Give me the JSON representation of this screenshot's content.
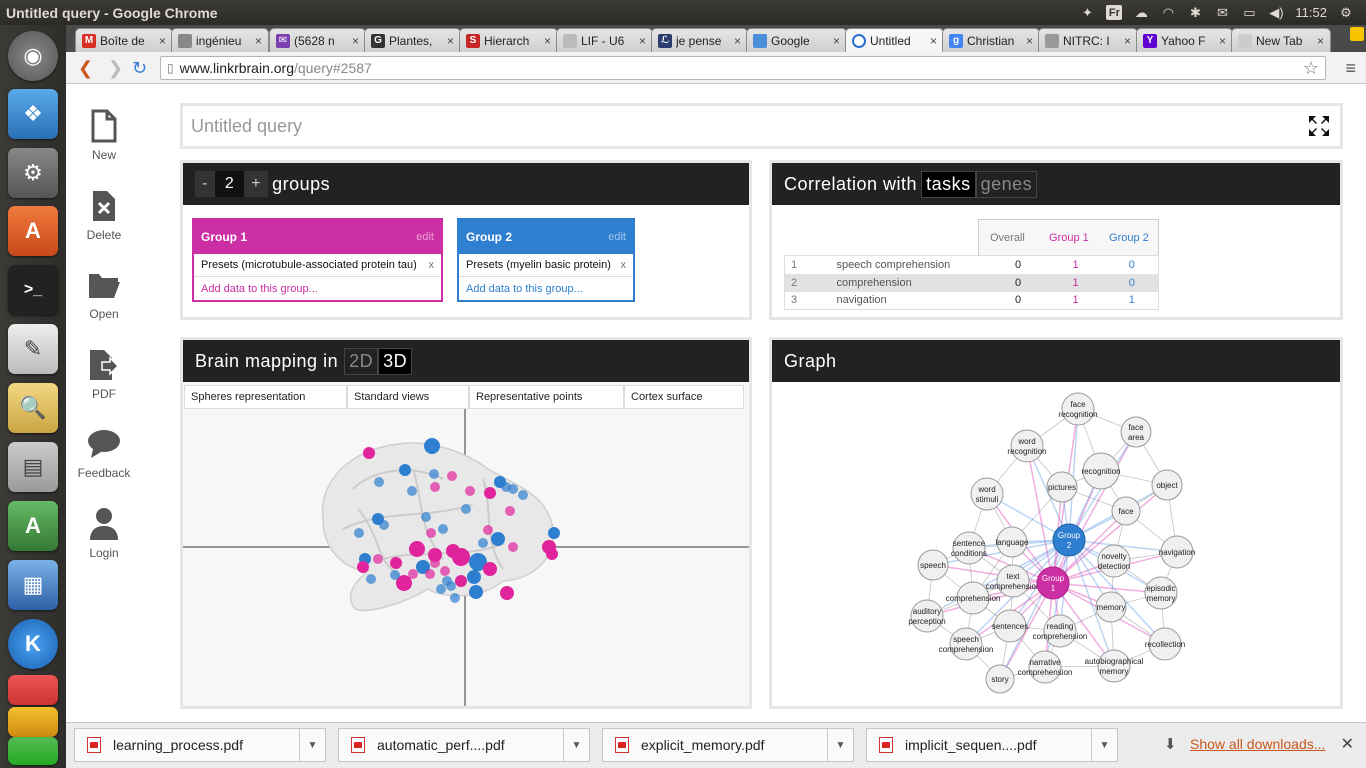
{
  "window": {
    "title": "Untitled query - Google Chrome"
  },
  "tray": {
    "lang": "Fr",
    "time": "11:52"
  },
  "tabs": [
    {
      "label": "Boîte de",
      "fav": "M",
      "color": "#d93025"
    },
    {
      "label": "ingénieu",
      "fav": "",
      "color": "#888888"
    },
    {
      "label": "(5628 n",
      "fav": "✉",
      "color": "#7b3fb0"
    },
    {
      "label": "Plantes,",
      "fav": "G",
      "color": "#333333"
    },
    {
      "label": "Hierarch",
      "fav": "S",
      "color": "#c62828"
    },
    {
      "label": "LIF - U6",
      "fav": "",
      "color": "#bbbbbb"
    },
    {
      "label": "je pense",
      "fav": "ℒ",
      "color": "#2c3e70"
    },
    {
      "label": "Google",
      "fav": "",
      "color": "#4a90d9"
    },
    {
      "label": "Untitled",
      "fav": "",
      "color": "#ffffff"
    },
    {
      "label": "Christian",
      "fav": "g",
      "color": "#4285f4"
    },
    {
      "label": "NITRC: I",
      "fav": "",
      "color": "#999999"
    },
    {
      "label": "Yahoo F",
      "fav": "Y",
      "color": "#5f01d1"
    },
    {
      "label": "New Tab",
      "fav": "",
      "color": "#cccccc"
    }
  ],
  "address": {
    "domain": "www.linkrbrain.org",
    "path": "/query#2587"
  },
  "sidebar": [
    {
      "label": "New",
      "icon": "new-file-icon"
    },
    {
      "label": "Delete",
      "icon": "delete-file-icon"
    },
    {
      "label": "Open",
      "icon": "folder-icon"
    },
    {
      "label": "PDF",
      "icon": "pdf-export-icon"
    },
    {
      "label": "Feedback",
      "icon": "speech-bubble-icon"
    },
    {
      "label": "Login",
      "icon": "user-icon"
    }
  ],
  "query": {
    "title": "Untitled query"
  },
  "groups_panel": {
    "minus": "-",
    "count": "2",
    "plus": "+",
    "label": "groups",
    "groups": [
      {
        "name": "Group 1",
        "edit": "edit",
        "item": "Presets (microtubule-associated protein tau)",
        "remove": "x",
        "add": "Add data to this group...",
        "color": "#cc2ea3"
      },
      {
        "name": "Group 2",
        "edit": "edit",
        "item": "Presets (myelin basic protein)",
        "remove": "x",
        "add": "Add data to this group...",
        "color": "#2f7fd0"
      }
    ]
  },
  "correlation": {
    "title": "Correlation with",
    "modes": [
      "tasks",
      "genes"
    ],
    "columns": [
      "Overall",
      "Group 1",
      "Group 2"
    ],
    "rows": [
      {
        "rank": "1",
        "name": "speech comprehension",
        "overall": "0",
        "g1": "1",
        "g2": "0"
      },
      {
        "rank": "2",
        "name": "comprehension",
        "overall": "0",
        "g1": "1",
        "g2": "0"
      },
      {
        "rank": "3",
        "name": "navigation",
        "overall": "0",
        "g1": "1",
        "g2": "1"
      }
    ]
  },
  "brain": {
    "title": "Brain mapping in",
    "modes": [
      "2D",
      "3D"
    ],
    "tabs": [
      "Spheres representation",
      "Standard views",
      "Representative points",
      "Cortex surface"
    ]
  },
  "graph": {
    "title": "Graph",
    "nodes": [
      {
        "id": "face-recognition",
        "l1": "face",
        "l2": "recognition"
      },
      {
        "id": "face-area",
        "l1": "face",
        "l2": "area"
      },
      {
        "id": "word-recognition",
        "l1": "word",
        "l2": "recognition"
      },
      {
        "id": "recognition",
        "l1": "recognition",
        "l2": ""
      },
      {
        "id": "object",
        "l1": "object",
        "l2": ""
      },
      {
        "id": "pictures",
        "l1": "pictures",
        "l2": ""
      },
      {
        "id": "word-stimuli",
        "l1": "word",
        "l2": "stimuli"
      },
      {
        "id": "face",
        "l1": "face",
        "l2": ""
      },
      {
        "id": "group2",
        "l1": "Group",
        "l2": "2"
      },
      {
        "id": "sentence-conditions",
        "l1": "sentence",
        "l2": "conditions"
      },
      {
        "id": "language",
        "l1": "language",
        "l2": ""
      },
      {
        "id": "novelty-detection",
        "l1": "novelty",
        "l2": "detection"
      },
      {
        "id": "navigation",
        "l1": "navigation",
        "l2": ""
      },
      {
        "id": "speech",
        "l1": "speech",
        "l2": ""
      },
      {
        "id": "text-comprehension",
        "l1": "text",
        "l2": "comprehension"
      },
      {
        "id": "group1",
        "l1": "Group",
        "l2": "1"
      },
      {
        "id": "episodic-memory",
        "l1": "episodic",
        "l2": "memory"
      },
      {
        "id": "comprehension",
        "l1": "comprehension",
        "l2": ""
      },
      {
        "id": "memory",
        "l1": "memory",
        "l2": ""
      },
      {
        "id": "auditory-perception",
        "l1": "auditory",
        "l2": "perception"
      },
      {
        "id": "sentences",
        "l1": "sentences",
        "l2": ""
      },
      {
        "id": "reading-comprehension",
        "l1": "reading",
        "l2": "comprehension"
      },
      {
        "id": "speech-comprehension",
        "l1": "speech",
        "l2": "comprehension"
      },
      {
        "id": "recollection",
        "l1": "recollection",
        "l2": ""
      },
      {
        "id": "narrative-comprehension",
        "l1": "narrative",
        "l2": "comprehension"
      },
      {
        "id": "autobiographical-memory",
        "l1": "autobiographical",
        "l2": "memory"
      },
      {
        "id": "story",
        "l1": "story",
        "l2": ""
      }
    ]
  },
  "downloads": {
    "items": [
      "learning_process.pdf",
      "automatic_perf....pdf",
      "explicit_memory.pdf",
      "implicit_sequen....pdf"
    ],
    "show_all": "Show all downloads..."
  },
  "colors": {
    "group1": "#cc2ea3",
    "group2": "#2f7fd0",
    "link": "#c9571c"
  }
}
